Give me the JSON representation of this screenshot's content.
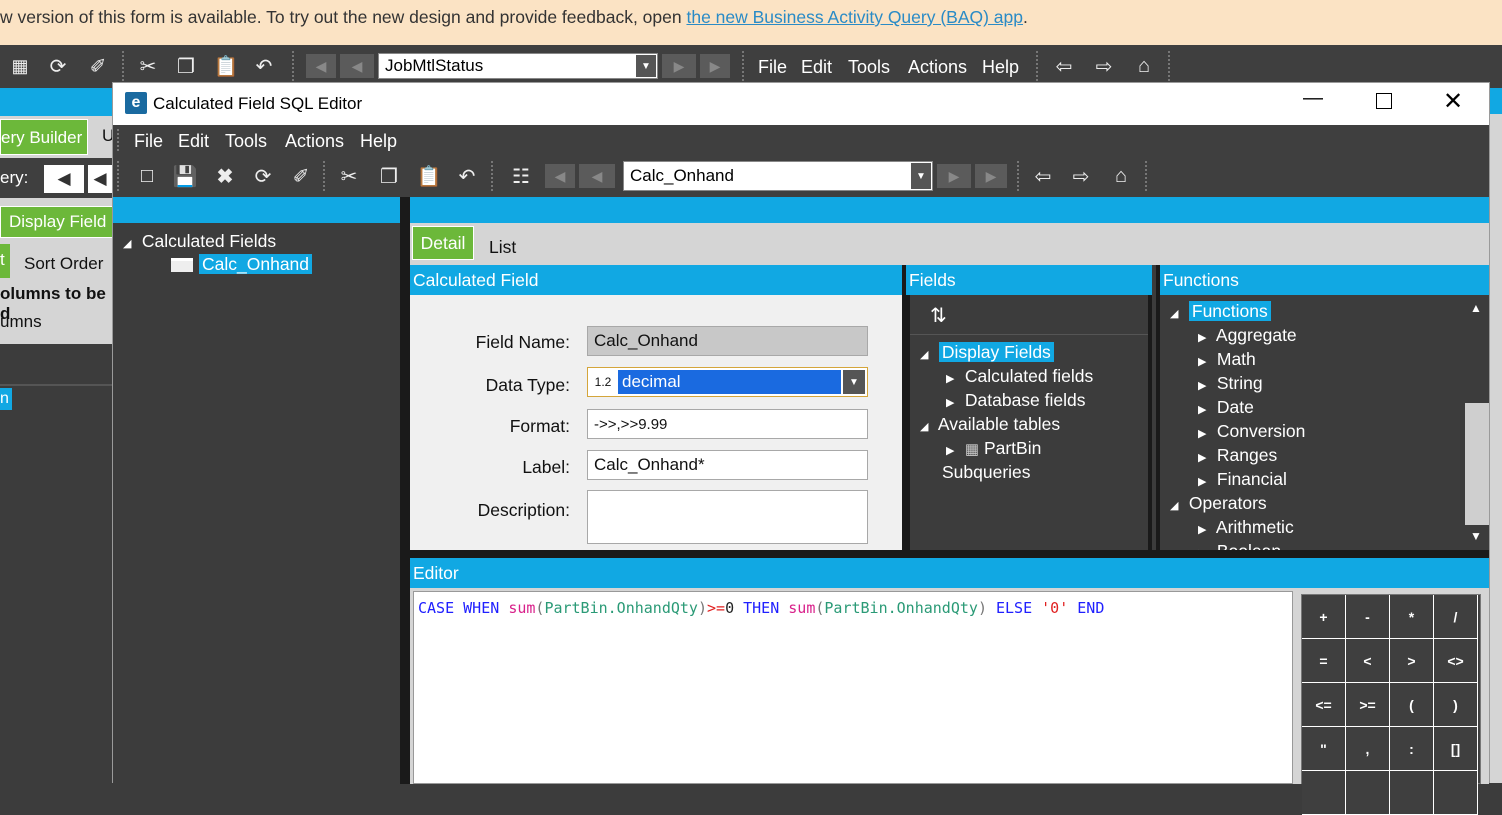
{
  "banner": {
    "text": "w version of this form is available. To try out the new design and provide feedback, open ",
    "link": "the new Business Activity Query (BAQ) app",
    "suffix": "."
  },
  "main_toolbar": {
    "combo_value": "JobMtlStatus",
    "menus": [
      "File",
      "Edit",
      "Tools",
      "Actions",
      "Help"
    ]
  },
  "background": {
    "query_builder_tab": "ery Builder",
    "u_tab": "U",
    "query_label": "ery:",
    "display_fields_tab": "Display Field",
    "t_tab": "t",
    "sort_order_tab": "Sort Order",
    "columns_bold": "olumns to be d",
    "columns": "umns",
    "n_item": "n"
  },
  "dialog": {
    "title": "Calculated Field SQL Editor",
    "menus": [
      "File",
      "Edit",
      "Tools",
      "Actions",
      "Help"
    ],
    "toolbar_combo": "Calc_Onhand",
    "tree": {
      "root": "Calculated Fields",
      "child": "Calc_Onhand"
    },
    "tabs": {
      "detail": "Detail",
      "list": "List"
    },
    "calc_field": {
      "header": "Calculated Field",
      "field_name_label": "Field Name:",
      "field_name": "Calc_Onhand",
      "data_type_label": "Data Type:",
      "data_type_badge": "1.2",
      "data_type": "decimal",
      "format_label": "Format:",
      "format": "->>,>>9.99",
      "label_label": "Label:",
      "label": "Calc_Onhand*",
      "description_label": "Description:",
      "description": ""
    },
    "fields": {
      "header": "Fields",
      "sort_icon": "↧",
      "display_fields": "Display Fields",
      "calculated_fields": "Calculated fields",
      "database_fields": "Database fields",
      "available_tables": "Available tables",
      "partbin": "PartBin",
      "subqueries": "Subqueries"
    },
    "functions": {
      "header": "Functions",
      "root": "Functions",
      "items": [
        "Aggregate",
        "Math",
        "String",
        "Date",
        "Conversion",
        "Ranges",
        "Financial"
      ],
      "operators": "Operators",
      "operator_items": [
        "Arithmetic",
        "Boolean"
      ]
    },
    "editor": {
      "header": "Editor",
      "tokens": [
        {
          "t": "CASE WHEN ",
          "c": "#2020ff"
        },
        {
          "t": "sum",
          "c": "#d8208a"
        },
        {
          "t": "(",
          "c": "#777"
        },
        {
          "t": "PartBin.OnhandQty",
          "c": "#2a9a76"
        },
        {
          "t": ")",
          "c": "#777"
        },
        {
          "t": ">=",
          "c": "#e02020"
        },
        {
          "t": "0 ",
          "c": "#222"
        },
        {
          "t": "THEN ",
          "c": "#2020ff"
        },
        {
          "t": "sum",
          "c": "#d8208a"
        },
        {
          "t": "(",
          "c": "#777"
        },
        {
          "t": "PartBin.OnhandQty",
          "c": "#2a9a76"
        },
        {
          "t": ") ",
          "c": "#777"
        },
        {
          "t": "ELSE ",
          "c": "#2020ff"
        },
        {
          "t": "'0' ",
          "c": "#e02020"
        },
        {
          "t": "END",
          "c": "#2020ff"
        }
      ]
    },
    "keypad": [
      [
        "+",
        "-",
        "*",
        "/"
      ],
      [
        "=",
        "<",
        ">",
        "<>"
      ],
      [
        "<=",
        ">=",
        "(",
        ")"
      ],
      [
        "\"",
        ",",
        ":",
        "[]"
      ],
      [
        "",
        "",
        "",
        ""
      ]
    ]
  }
}
